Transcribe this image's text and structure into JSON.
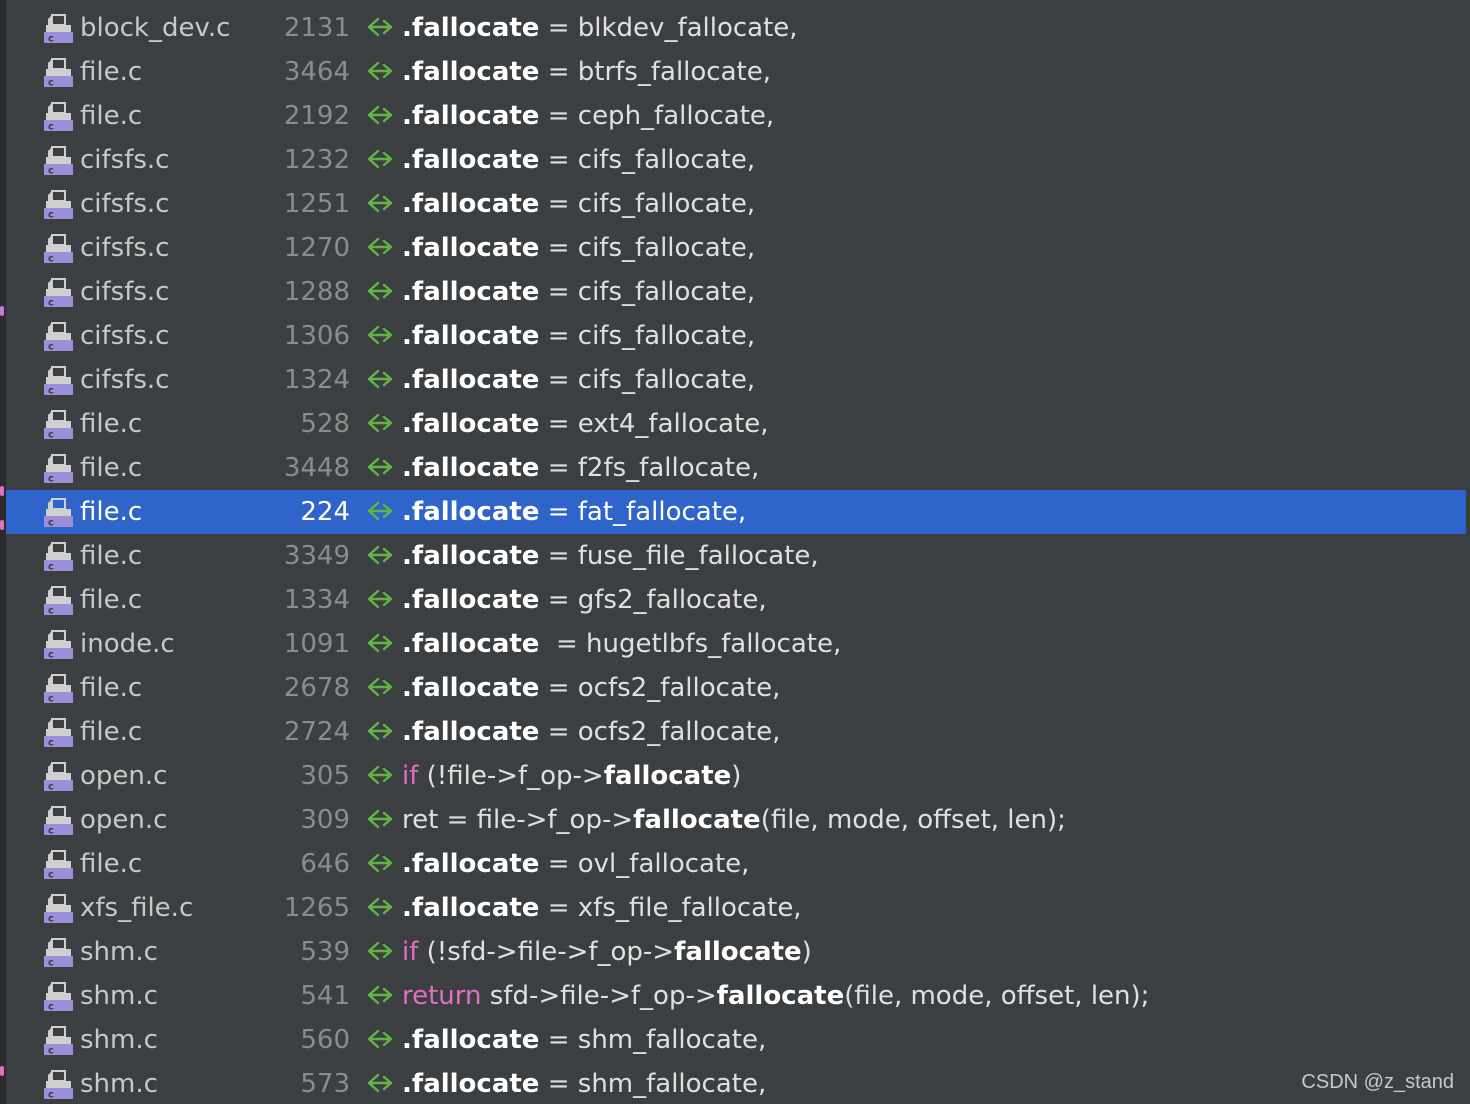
{
  "colors": {
    "background": "#3c3f41",
    "selection": "#2f65ca",
    "keyword": "#e06ec2",
    "usage_icon": "#62b543",
    "file_icon": "#9a8fd8",
    "line_number": "#8c8c8c"
  },
  "icons": {
    "file": "c-source-file-icon",
    "usage": "usage-arrow-icon"
  },
  "selected_index": 11,
  "rows": [
    {
      "file": "block_dev.c",
      "line": "2131",
      "code": [
        {
          "t": ".fallocate",
          "s": "hl"
        },
        {
          "t": " = blkdev_fallocate,"
        }
      ]
    },
    {
      "file": "file.c",
      "line": "3464",
      "code": [
        {
          "t": ".fallocate",
          "s": "hl"
        },
        {
          "t": " = btrfs_fallocate,"
        }
      ]
    },
    {
      "file": "file.c",
      "line": "2192",
      "code": [
        {
          "t": ".fallocate",
          "s": "hl"
        },
        {
          "t": " = ceph_fallocate,"
        }
      ]
    },
    {
      "file": "cifsfs.c",
      "line": "1232",
      "code": [
        {
          "t": ".fallocate",
          "s": "hl"
        },
        {
          "t": " = cifs_fallocate,"
        }
      ]
    },
    {
      "file": "cifsfs.c",
      "line": "1251",
      "code": [
        {
          "t": ".fallocate",
          "s": "hl"
        },
        {
          "t": " = cifs_fallocate,"
        }
      ]
    },
    {
      "file": "cifsfs.c",
      "line": "1270",
      "code": [
        {
          "t": ".fallocate",
          "s": "hl"
        },
        {
          "t": " = cifs_fallocate,"
        }
      ]
    },
    {
      "file": "cifsfs.c",
      "line": "1288",
      "code": [
        {
          "t": ".fallocate",
          "s": "hl"
        },
        {
          "t": " = cifs_fallocate,"
        }
      ]
    },
    {
      "file": "cifsfs.c",
      "line": "1306",
      "code": [
        {
          "t": ".fallocate",
          "s": "hl"
        },
        {
          "t": " = cifs_fallocate,"
        }
      ]
    },
    {
      "file": "cifsfs.c",
      "line": "1324",
      "code": [
        {
          "t": ".fallocate",
          "s": "hl"
        },
        {
          "t": " = cifs_fallocate,"
        }
      ]
    },
    {
      "file": "file.c",
      "line": "528",
      "code": [
        {
          "t": ".fallocate",
          "s": "hl"
        },
        {
          "t": " = ext4_fallocate,"
        }
      ]
    },
    {
      "file": "file.c",
      "line": "3448",
      "code": [
        {
          "t": ".fallocate",
          "s": "hl"
        },
        {
          "t": " = f2fs_fallocate,"
        }
      ]
    },
    {
      "file": "file.c",
      "line": "224",
      "code": [
        {
          "t": ".fallocate",
          "s": "hl"
        },
        {
          "t": " = fat_fallocate,"
        }
      ]
    },
    {
      "file": "file.c",
      "line": "3349",
      "code": [
        {
          "t": ".fallocate",
          "s": "hl"
        },
        {
          "t": " = fuse_file_fallocate,"
        }
      ]
    },
    {
      "file": "file.c",
      "line": "1334",
      "code": [
        {
          "t": ".fallocate",
          "s": "hl"
        },
        {
          "t": " = gfs2_fallocate,"
        }
      ]
    },
    {
      "file": "inode.c",
      "line": "1091",
      "code": [
        {
          "t": ".fallocate",
          "s": "hl"
        },
        {
          "t": "  = hugetlbfs_fallocate,"
        }
      ]
    },
    {
      "file": "file.c",
      "line": "2678",
      "code": [
        {
          "t": ".fallocate",
          "s": "hl"
        },
        {
          "t": " = ocfs2_fallocate,"
        }
      ]
    },
    {
      "file": "file.c",
      "line": "2724",
      "code": [
        {
          "t": ".fallocate",
          "s": "hl"
        },
        {
          "t": " = ocfs2_fallocate,"
        }
      ]
    },
    {
      "file": "open.c",
      "line": "305",
      "code": [
        {
          "t": "if",
          "s": "kw"
        },
        {
          "t": " (!file->f_op->"
        },
        {
          "t": "fallocate",
          "s": "hl"
        },
        {
          "t": ")"
        }
      ]
    },
    {
      "file": "open.c",
      "line": "309",
      "code": [
        {
          "t": "ret = file->f_op->"
        },
        {
          "t": "fallocate",
          "s": "hl"
        },
        {
          "t": "(file, mode, offset, len);"
        }
      ]
    },
    {
      "file": "file.c",
      "line": "646",
      "code": [
        {
          "t": ".fallocate",
          "s": "hl"
        },
        {
          "t": " = ovl_fallocate,"
        }
      ]
    },
    {
      "file": "xfs_file.c",
      "line": "1265",
      "code": [
        {
          "t": ".fallocate",
          "s": "hl"
        },
        {
          "t": " = xfs_file_fallocate,"
        }
      ]
    },
    {
      "file": "shm.c",
      "line": "539",
      "code": [
        {
          "t": "if",
          "s": "kw"
        },
        {
          "t": " (!sfd->file->f_op->"
        },
        {
          "t": "fallocate",
          "s": "hl"
        },
        {
          "t": ")"
        }
      ]
    },
    {
      "file": "shm.c",
      "line": "541",
      "code": [
        {
          "t": "return",
          "s": "kw"
        },
        {
          "t": " sfd->file->f_op->"
        },
        {
          "t": "fallocate",
          "s": "hl"
        },
        {
          "t": "(file, mode, offset, len);"
        }
      ]
    },
    {
      "file": "shm.c",
      "line": "560",
      "code": [
        {
          "t": ".fallocate",
          "s": "hl"
        },
        {
          "t": " = shm_fallocate,"
        }
      ]
    },
    {
      "file": "shm.c",
      "line": "573",
      "code": [
        {
          "t": ".fallocate",
          "s": "hl"
        },
        {
          "t": " = shm_fallocate,"
        }
      ]
    }
  ],
  "watermark": "CSDN @z_stand"
}
